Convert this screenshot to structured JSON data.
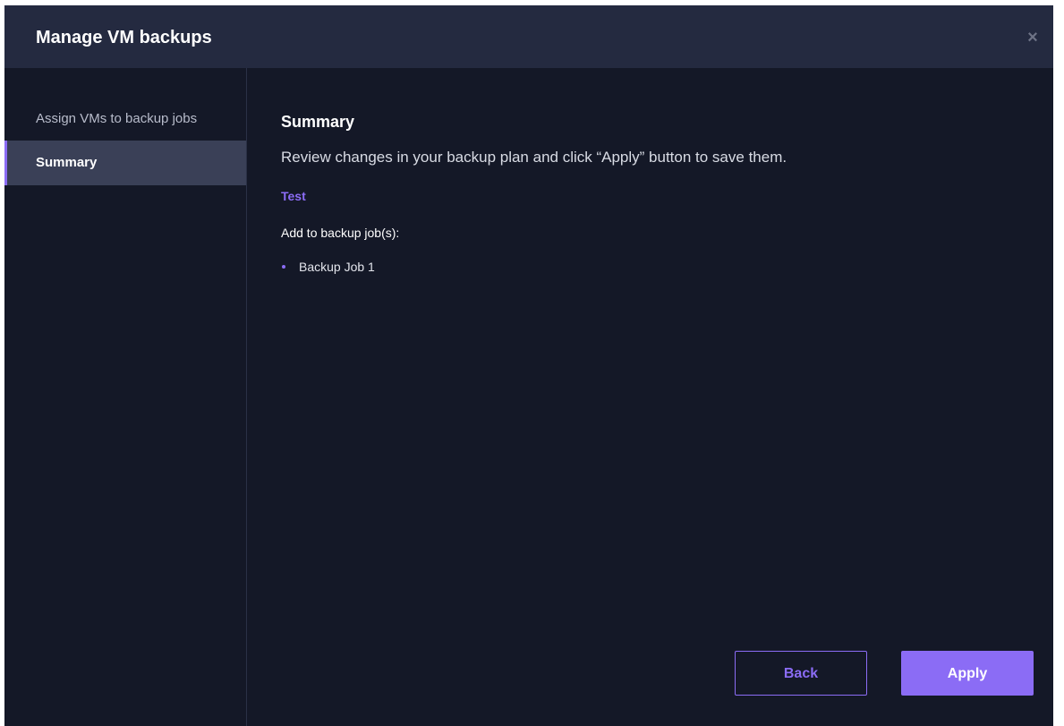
{
  "dialog": {
    "title": "Manage VM backups",
    "close_icon": "close-icon"
  },
  "sidebar": {
    "items": [
      {
        "label": "Assign VMs to backup jobs",
        "active": false
      },
      {
        "label": "Summary",
        "active": true
      }
    ]
  },
  "summary": {
    "title": "Summary",
    "description": "Review changes in your backup plan and click “Apply” button to save them.",
    "vm_name": "Test",
    "action_label": "Add to backup job(s):",
    "jobs": [
      "Backup Job 1"
    ]
  },
  "buttons": {
    "back_label": "Back",
    "apply_label": "Apply"
  },
  "colors": {
    "background": "#141827",
    "header": "#242a40",
    "accent": "#8b6cf5",
    "active_nav": "#3a4057"
  }
}
